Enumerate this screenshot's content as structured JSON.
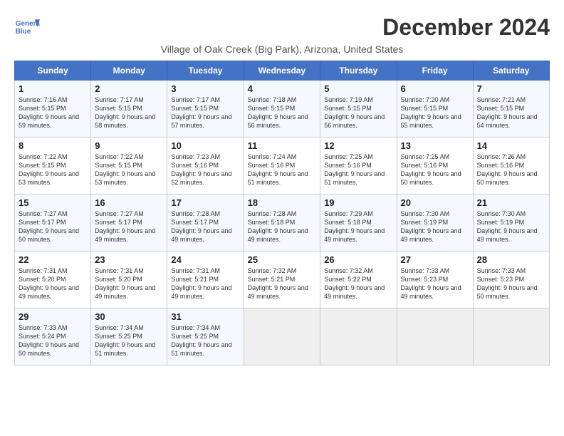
{
  "header": {
    "month_title": "December 2024",
    "location": "Village of Oak Creek (Big Park), Arizona, United States",
    "logo_line1": "General",
    "logo_line2": "Blue"
  },
  "days_of_week": [
    "Sunday",
    "Monday",
    "Tuesday",
    "Wednesday",
    "Thursday",
    "Friday",
    "Saturday"
  ],
  "weeks": [
    [
      {
        "day": "1",
        "sunrise": "7:16 AM",
        "sunset": "5:15 PM",
        "daylight": "9 hours and 59 minutes."
      },
      {
        "day": "2",
        "sunrise": "7:17 AM",
        "sunset": "5:15 PM",
        "daylight": "9 hours and 58 minutes."
      },
      {
        "day": "3",
        "sunrise": "7:17 AM",
        "sunset": "5:15 PM",
        "daylight": "9 hours and 57 minutes."
      },
      {
        "day": "4",
        "sunrise": "7:18 AM",
        "sunset": "5:15 PM",
        "daylight": "9 hours and 56 minutes."
      },
      {
        "day": "5",
        "sunrise": "7:19 AM",
        "sunset": "5:15 PM",
        "daylight": "9 hours and 56 minutes."
      },
      {
        "day": "6",
        "sunrise": "7:20 AM",
        "sunset": "5:15 PM",
        "daylight": "9 hours and 55 minutes."
      },
      {
        "day": "7",
        "sunrise": "7:21 AM",
        "sunset": "5:15 PM",
        "daylight": "9 hours and 54 minutes."
      }
    ],
    [
      {
        "day": "8",
        "sunrise": "7:22 AM",
        "sunset": "5:15 PM",
        "daylight": "9 hours and 53 minutes."
      },
      {
        "day": "9",
        "sunrise": "7:22 AM",
        "sunset": "5:15 PM",
        "daylight": "9 hours and 53 minutes."
      },
      {
        "day": "10",
        "sunrise": "7:23 AM",
        "sunset": "5:16 PM",
        "daylight": "9 hours and 52 minutes."
      },
      {
        "day": "11",
        "sunrise": "7:24 AM",
        "sunset": "5:16 PM",
        "daylight": "9 hours and 51 minutes."
      },
      {
        "day": "12",
        "sunrise": "7:25 AM",
        "sunset": "5:16 PM",
        "daylight": "9 hours and 51 minutes."
      },
      {
        "day": "13",
        "sunrise": "7:25 AM",
        "sunset": "5:16 PM",
        "daylight": "9 hours and 50 minutes."
      },
      {
        "day": "14",
        "sunrise": "7:26 AM",
        "sunset": "5:16 PM",
        "daylight": "9 hours and 50 minutes."
      }
    ],
    [
      {
        "day": "15",
        "sunrise": "7:27 AM",
        "sunset": "5:17 PM",
        "daylight": "9 hours and 50 minutes."
      },
      {
        "day": "16",
        "sunrise": "7:27 AM",
        "sunset": "5:17 PM",
        "daylight": "9 hours and 49 minutes."
      },
      {
        "day": "17",
        "sunrise": "7:28 AM",
        "sunset": "5:17 PM",
        "daylight": "9 hours and 49 minutes."
      },
      {
        "day": "18",
        "sunrise": "7:28 AM",
        "sunset": "5:18 PM",
        "daylight": "9 hours and 49 minutes."
      },
      {
        "day": "19",
        "sunrise": "7:29 AM",
        "sunset": "5:18 PM",
        "daylight": "9 hours and 49 minutes."
      },
      {
        "day": "20",
        "sunrise": "7:30 AM",
        "sunset": "5:19 PM",
        "daylight": "9 hours and 49 minutes."
      },
      {
        "day": "21",
        "sunrise": "7:30 AM",
        "sunset": "5:19 PM",
        "daylight": "9 hours and 49 minutes."
      }
    ],
    [
      {
        "day": "22",
        "sunrise": "7:31 AM",
        "sunset": "5:20 PM",
        "daylight": "9 hours and 49 minutes."
      },
      {
        "day": "23",
        "sunrise": "7:31 AM",
        "sunset": "5:20 PM",
        "daylight": "9 hours and 49 minutes."
      },
      {
        "day": "24",
        "sunrise": "7:31 AM",
        "sunset": "5:21 PM",
        "daylight": "9 hours and 49 minutes."
      },
      {
        "day": "25",
        "sunrise": "7:32 AM",
        "sunset": "5:21 PM",
        "daylight": "9 hours and 49 minutes."
      },
      {
        "day": "26",
        "sunrise": "7:32 AM",
        "sunset": "5:22 PM",
        "daylight": "9 hours and 49 minutes."
      },
      {
        "day": "27",
        "sunrise": "7:33 AM",
        "sunset": "5:23 PM",
        "daylight": "9 hours and 49 minutes."
      },
      {
        "day": "28",
        "sunrise": "7:33 AM",
        "sunset": "5:23 PM",
        "daylight": "9 hours and 50 minutes."
      }
    ],
    [
      {
        "day": "29",
        "sunrise": "7:33 AM",
        "sunset": "5:24 PM",
        "daylight": "9 hours and 50 minutes."
      },
      {
        "day": "30",
        "sunrise": "7:34 AM",
        "sunset": "5:25 PM",
        "daylight": "9 hours and 51 minutes."
      },
      {
        "day": "31",
        "sunrise": "7:34 AM",
        "sunset": "5:25 PM",
        "daylight": "9 hours and 51 minutes."
      },
      null,
      null,
      null,
      null
    ]
  ]
}
